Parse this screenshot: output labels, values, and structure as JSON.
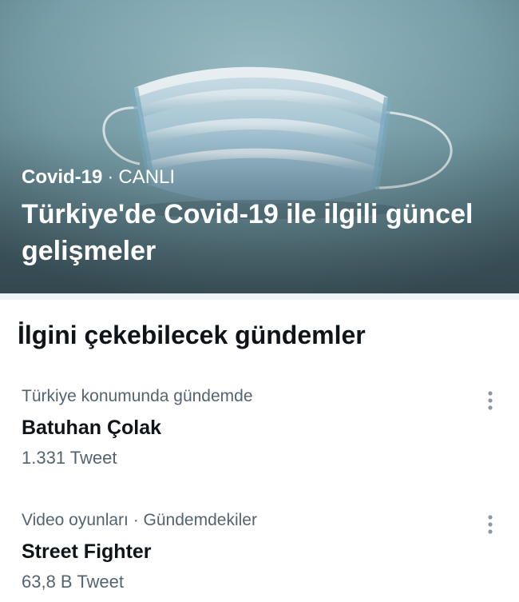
{
  "hero": {
    "topic": "Covid-19",
    "separator": "·",
    "status": "CANLI",
    "title": "Türkiye'de Covid-19 ile ilgili güncel gelişmeler"
  },
  "section": {
    "title": "İlgini çekebilecek gündemler"
  },
  "trends": [
    {
      "context": "Türkiye konumunda gündemde",
      "name": "Batuhan Çolak",
      "count": "1.331 Tweet"
    },
    {
      "context": "Video oyunları · Gündemdekiler",
      "name": "Street Fighter",
      "count": "63,8 B Tweet"
    }
  ],
  "icons": {
    "hero_image": "face-mask-image",
    "more": "more-vertical-icon"
  },
  "colors": {
    "primary_text": "#0f1419",
    "secondary_text": "#536471",
    "divider": "#eff3f4",
    "icon": "#8b98a5"
  }
}
